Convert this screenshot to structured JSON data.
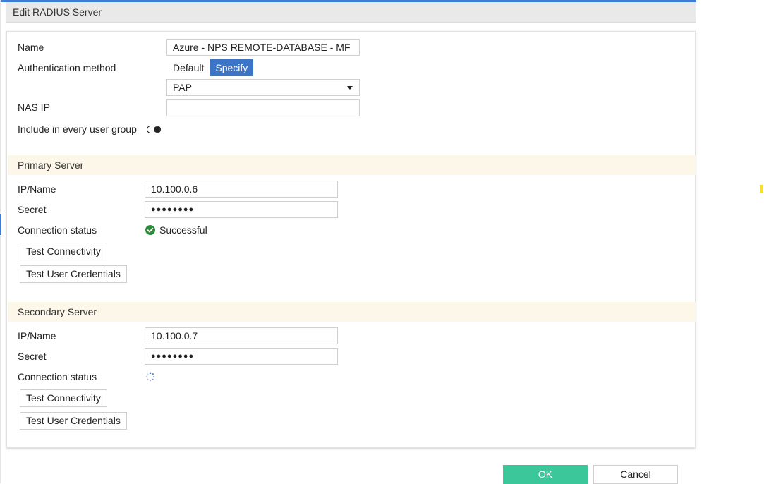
{
  "dialog": {
    "title": "Edit RADIUS Server"
  },
  "general": {
    "name_label": "Name",
    "name_value": "Azure - NPS REMOTE-DATABASE  - MF",
    "auth_label": "Authentication method",
    "auth_options": [
      "Default",
      "Specify"
    ],
    "auth_selected": "Specify",
    "auth_protocol": "PAP",
    "nas_ip_label": "NAS IP",
    "nas_ip_value": "",
    "include_label": "Include in every user group",
    "include_enabled": false
  },
  "primary": {
    "section_title": "Primary Server",
    "ip_label": "IP/Name",
    "ip_value": "10.100.0.6",
    "secret_label": "Secret",
    "secret_value": "●●●●●●●●",
    "status_label": "Connection status",
    "status_text": "Successful",
    "test_connectivity": "Test Connectivity",
    "test_credentials": "Test User Credentials"
  },
  "secondary": {
    "section_title": "Secondary Server",
    "ip_label": "IP/Name",
    "ip_value": "10.100.0.7",
    "secret_label": "Secret",
    "secret_value": "●●●●●●●●",
    "status_label": "Connection status",
    "status_state": "loading",
    "test_connectivity": "Test Connectivity",
    "test_credentials": "Test User Credentials"
  },
  "footer": {
    "ok_label": "OK",
    "cancel_label": "Cancel"
  },
  "colors": {
    "accent": "#3c74c8",
    "ok": "#3cc79b",
    "success": "#2e8b3a",
    "section_bg": "#fdf7e9"
  }
}
